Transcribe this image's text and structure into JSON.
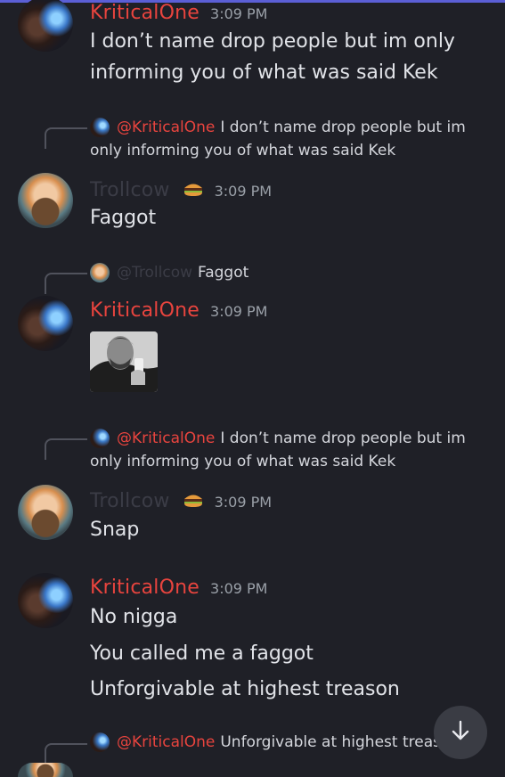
{
  "accent": "#5b5fd6",
  "colors": {
    "kritical_name": "#e8443e",
    "trollcow_name": "#3b3c46",
    "timestamp": "#9aa0a8",
    "background": "#1f2027"
  },
  "messages": [
    {
      "author": "KriticalOne",
      "time": "3:09 PM",
      "lines": [
        "I don’t name drop people but im only",
        "informing you of what was said Kek"
      ]
    },
    {
      "reply_to": {
        "author": "@KriticalOne",
        "text_line1": "I don’t name drop people but im",
        "text_line2": "only informing you of what was said Kek"
      },
      "author": "Trollcow",
      "author_emoji": "burger-emoji",
      "time": "3:09 PM",
      "lines": [
        "Faggot"
      ]
    },
    {
      "reply_to": {
        "author": "@Trollcow",
        "text": "Faggot"
      },
      "author": "KriticalOne",
      "time": "3:09 PM",
      "attachment": "gigachad-gif"
    },
    {
      "reply_to": {
        "author": "@KriticalOne",
        "text_line1": "I don’t name drop people but im",
        "text_line2": "only informing you of what was said Kek"
      },
      "author": "Trollcow",
      "author_emoji": "burger-emoji",
      "time": "3:09 PM",
      "lines": [
        "Snap"
      ]
    },
    {
      "author": "KriticalOne",
      "time": "3:09 PM",
      "lines": [
        "No nigga",
        "You called me a faggot",
        "Unforgivable at highest treason"
      ]
    },
    {
      "reply_to": {
        "author": "@KriticalOne",
        "text": "Unforgivable at highest treas"
      }
    }
  ],
  "scroll_button_icon": "arrow-down-icon"
}
